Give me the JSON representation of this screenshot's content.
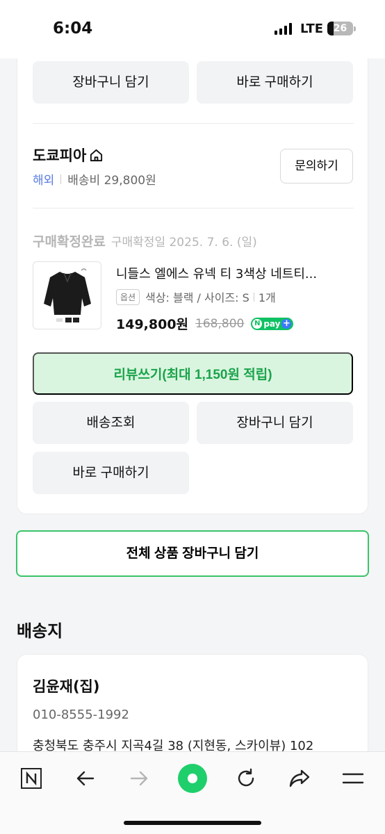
{
  "status_bar": {
    "time": "6:04",
    "network": "LTE",
    "battery": "26"
  },
  "order": {
    "top_buttons": {
      "cart": "장바구니 담기",
      "buy": "바로 구매하기"
    },
    "seller": {
      "name": "도쿄피아",
      "origin": "해외",
      "shipping_fee": "배송비 29,800원",
      "inquiry_label": "문의하기"
    },
    "status": "구매확정완료",
    "status_date": "구매확정일 2025. 7. 6. (일)",
    "product": {
      "name": "니들스 엘에스 유넥 티 3색상 네트티...",
      "option_tag": "옵션",
      "option": "색상: 블랙 / 사이즈: S",
      "quantity": "1개",
      "price": "149,800원",
      "original_price": "168,800",
      "npay_label": "pay"
    },
    "review_button": "리뷰쓰기(최대 1,150원 적립)",
    "actions": {
      "track": "배송조회",
      "cart": "장바구니 담기",
      "buy": "바로 구매하기"
    }
  },
  "all_cart_button": "전체 상품 장바구니 담기",
  "shipping": {
    "title": "배송지",
    "name": "김윤재(집)",
    "phone": "010-8555-1992",
    "address": "충청북도 충주시 지곡4길 38 (지현동, 스카이뷰) 102"
  },
  "toolbar": {
    "icons": [
      "naver-n-icon",
      "back-arrow-icon",
      "forward-arrow-icon",
      "home-dot-icon",
      "refresh-icon",
      "share-icon",
      "menu-icon"
    ]
  },
  "colors": {
    "accent_green": "#1aa34b",
    "review_bg": "#daf5df",
    "overseas_blue": "#5a7de0",
    "npay_green": "#0fc163"
  }
}
